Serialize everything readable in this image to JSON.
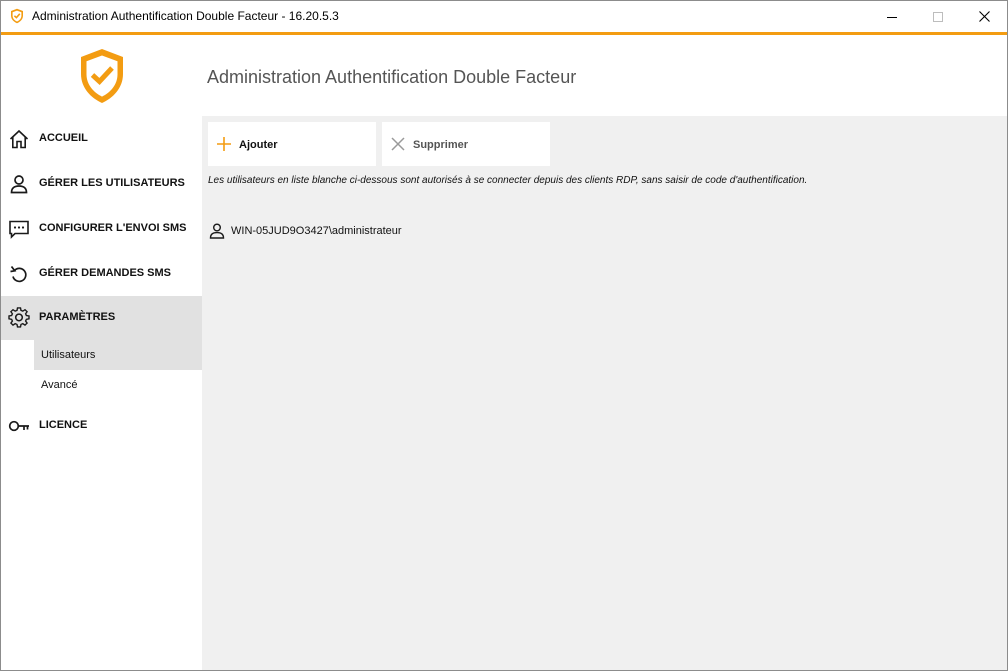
{
  "window": {
    "title": "Administration Authentification Double Facteur - 16.20.5.3",
    "accent_color": "#f39c12"
  },
  "header": {
    "title": "Administration Authentification Double Facteur"
  },
  "sidebar": {
    "items": [
      {
        "label": "ACCUEIL",
        "icon": "home-icon"
      },
      {
        "label": "GÉRER LES UTILISATEURS",
        "icon": "user-icon"
      },
      {
        "label": "CONFIGURER L'ENVOI SMS",
        "icon": "message-icon"
      },
      {
        "label": "GÉRER DEMANDES SMS",
        "icon": "refresh-icon"
      },
      {
        "label": "PARAMÈTRES",
        "icon": "gear-icon",
        "selected": true
      },
      {
        "label": "LICENCE",
        "icon": "key-icon"
      }
    ],
    "submenu": [
      {
        "label": "Utilisateurs",
        "selected": true
      },
      {
        "label": "Avancé"
      }
    ]
  },
  "toolbar": {
    "add_label": "Ajouter",
    "delete_label": "Supprimer"
  },
  "info_text": "Les utilisateurs en liste blanche ci-dessous sont autorisés à se connecter depuis des clients RDP, sans saisir de code d'authentification.",
  "whitelist": [
    {
      "name": "WIN-05JUD9O3427\\administrateur"
    }
  ]
}
